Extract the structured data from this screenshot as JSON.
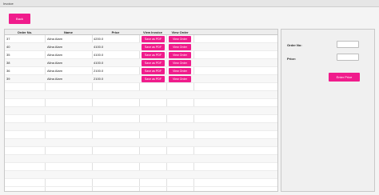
{
  "window": {
    "title": "Invoice"
  },
  "toolbar": {
    "back_label": "Back"
  },
  "table": {
    "columns": [
      "Order No.",
      "Name",
      "Price",
      "View Invoice",
      "View Order"
    ],
    "rows": [
      {
        "order_no": "37",
        "name": "Alina Alam",
        "price": "4200.0",
        "invoice_btn": "Save as PDF",
        "order_btn": "View Order"
      },
      {
        "order_no": "40",
        "name": "Alina Alam",
        "price": "4100.0",
        "invoice_btn": "Save as PDF",
        "order_btn": "View Order"
      },
      {
        "order_no": "35",
        "name": "Alina Alam",
        "price": "4100.0",
        "invoice_btn": "Save as PDF",
        "order_btn": "View Order"
      },
      {
        "order_no": "38",
        "name": "Alina Alam",
        "price": "4100.0",
        "invoice_btn": "Save as PDF",
        "order_btn": "View Order"
      },
      {
        "order_no": "36",
        "name": "Alina Alam",
        "price": "2100.0",
        "invoice_btn": "Save as PDF",
        "order_btn": "View Order"
      },
      {
        "order_no": "39",
        "name": "Alina Alam",
        "price": "2100.0",
        "invoice_btn": "Save as PDF",
        "order_btn": "View Order"
      }
    ]
  },
  "side_panel": {
    "order_no_label": "Order No:",
    "order_no_value": "",
    "price_label": "Price:",
    "price_value": "",
    "enter_price_label": "Enter Price"
  },
  "colors": {
    "accent": "#f01c8c"
  }
}
